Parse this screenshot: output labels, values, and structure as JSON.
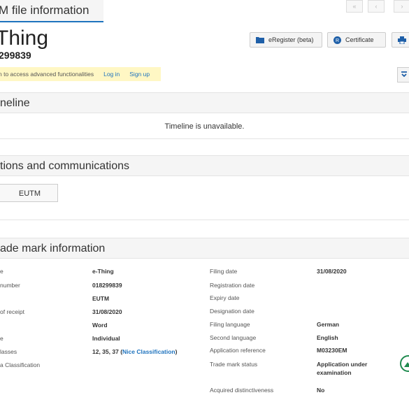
{
  "tab": {
    "label": "M file information"
  },
  "header": {
    "title": "Thing",
    "number": "299839"
  },
  "toolbar": {
    "eregister_label": "eRegister (beta)",
    "certificate_label": "Certificate"
  },
  "notice": {
    "text": "n to access advanced functionalities",
    "login": "Log in",
    "signup": "Sign up"
  },
  "sections": {
    "timeline": {
      "title": "neline",
      "message": "Timeline is unavailable."
    },
    "publications": {
      "title": "tions and communications",
      "eutm_label": "EUTM"
    },
    "tm_info": {
      "title": "ade mark information"
    }
  },
  "left_fields": [
    {
      "label": "e",
      "value": "e-Thing"
    },
    {
      "label": "number",
      "value": "018299839"
    },
    {
      "label": "",
      "value": "EUTM"
    },
    {
      "label": "of receipt",
      "value": "31/08/2020"
    },
    {
      "label": "",
      "value": "Word"
    },
    {
      "label": "e",
      "value": "Individual"
    },
    {
      "label": "lasses",
      "value": "12, 35, 37",
      "link": "Nice Classification"
    },
    {
      "label": "a Classification",
      "value": ""
    }
  ],
  "right_fields": [
    {
      "label": "Filing date",
      "value": "31/08/2020"
    },
    {
      "label": "Registration date",
      "value": ""
    },
    {
      "label": "Expiry date",
      "value": ""
    },
    {
      "label": "Designation date",
      "value": ""
    },
    {
      "label": "Filing language",
      "value": "German"
    },
    {
      "label": "Second language",
      "value": "English"
    },
    {
      "label": "Application reference",
      "value": "M03230EM"
    },
    {
      "label": "Trade mark status",
      "value": "Application under",
      "value2": "examination"
    },
    {
      "label": "Acquired distinctiveness",
      "value": "No"
    }
  ],
  "icons": [
    "folder-icon",
    "certificate-icon",
    "print-icon",
    "chevron-down-icon",
    "mountain-icon"
  ],
  "colors": {
    "accent": "#1e73be",
    "notice_bg": "#fff7c4",
    "section_bg": "#f5f5f5"
  }
}
